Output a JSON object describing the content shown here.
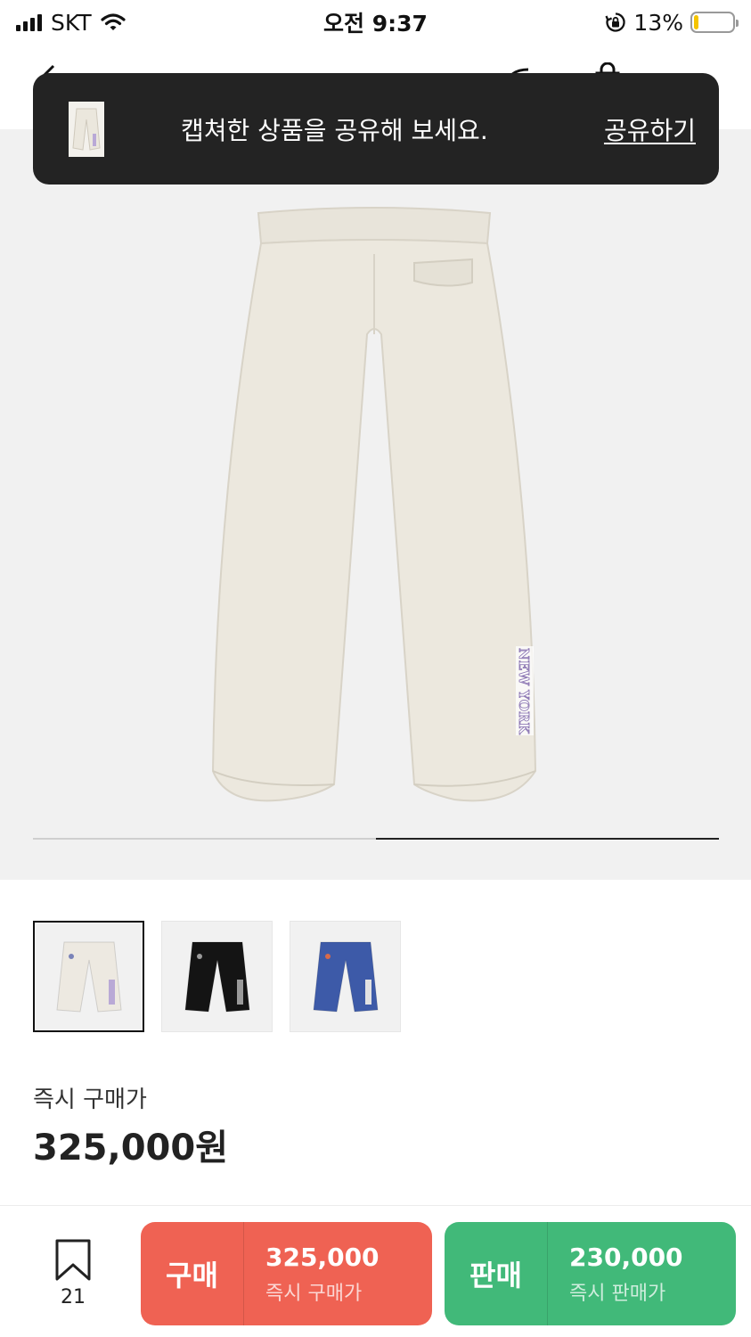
{
  "status_bar": {
    "carrier": "SKT",
    "time": "오전 9:37",
    "battery": "13%",
    "battery_level": 0.13
  },
  "toast": {
    "message": "캡쳐한 상품을 공유해 보세요.",
    "action": "공유하기"
  },
  "gallery": {
    "print_text": "NEW YORK",
    "progress": {
      "current": 2,
      "total": 2
    }
  },
  "thumbnails": [
    {
      "color": "#ede9e1",
      "selected": true
    },
    {
      "color": "#141414",
      "selected": false
    },
    {
      "color": "#3d5aa8",
      "selected": false
    }
  ],
  "price": {
    "label": "즉시 구매가",
    "value": "325,000원"
  },
  "bottom": {
    "wish_count": "21",
    "buy": {
      "label": "구매",
      "price": "325,000",
      "sub": "즉시 구매가",
      "color": "#ef6253"
    },
    "sell": {
      "label": "판매",
      "price": "230,000",
      "sub": "즉시 판매가",
      "color": "#41b979"
    }
  }
}
